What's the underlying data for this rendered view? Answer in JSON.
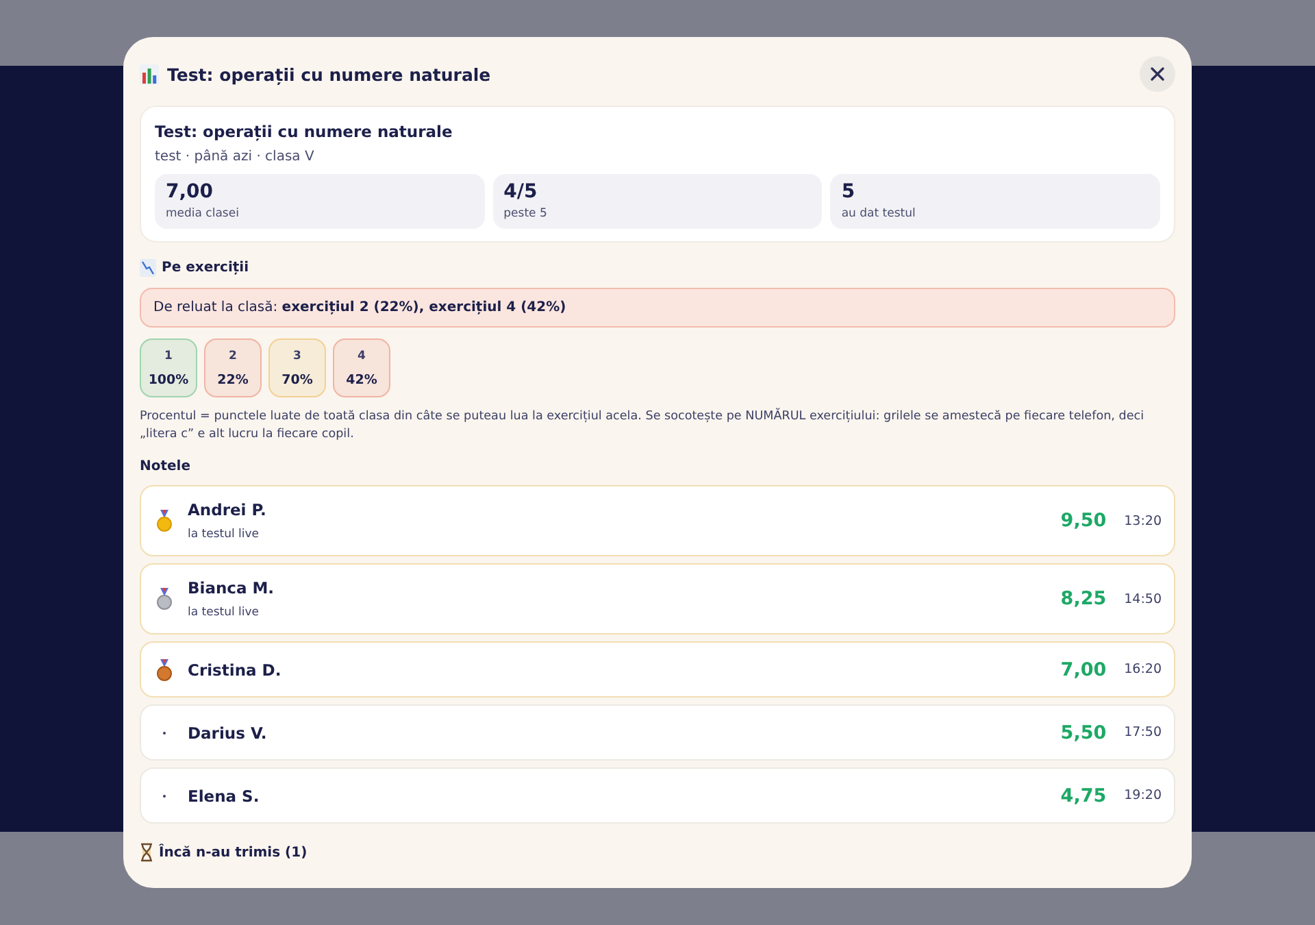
{
  "modal": {
    "title": "Test: operații cu numere naturale"
  },
  "summary": {
    "title": "Test: operații cu numere naturale",
    "meta": "test · până azi · clasa V",
    "stats": [
      {
        "value": "7,00",
        "label": "media clasei"
      },
      {
        "value": "4/5",
        "label": "peste 5"
      },
      {
        "value": "5",
        "label": "au dat testul"
      }
    ]
  },
  "exercises": {
    "heading": "Pe exerciții",
    "alert": "De reluat la clasă: **exercițiul 2 (22%), exercițiul 4 (42%)**",
    "items": [
      {
        "number": "1",
        "percent": "100%",
        "color": "#9fd4ae"
      },
      {
        "number": "2",
        "percent": "22%",
        "color": "#f0b4a4"
      },
      {
        "number": "3",
        "percent": "70%",
        "color": "#f1d294"
      },
      {
        "number": "4",
        "percent": "42%",
        "color": "#f0b4a4"
      }
    ],
    "note": "Procentul = punctele luate de toată clasa din câte se puteau lua la exercițiul acela. Se socotește pe NUMĂRUL exercițiului: grilele se amestecă pe fiecare telefon, deci „litera c” e alt lucru la fiecare copil."
  },
  "grades": {
    "heading": "Notele",
    "rows": [
      {
        "name": "Andrei P.",
        "source": "la testul live",
        "grade": "9,50",
        "time": "13:20",
        "kind": "gold"
      },
      {
        "name": "Bianca M.",
        "source": "la testul live",
        "grade": "8,25",
        "time": "14:50",
        "kind": "silver"
      },
      {
        "name": "Cristina D.",
        "grade": "7,00",
        "time": "16:20",
        "kind": "bronze"
      },
      {
        "name": "Darius V.",
        "grade": "5,50",
        "time": "17:50",
        "kind": "plain"
      },
      {
        "name": "Elena S.",
        "grade": "4,75",
        "time": "19:20",
        "kind": "plain"
      }
    ]
  },
  "pending": {
    "heading": "Încă n-au trimis (1)"
  }
}
